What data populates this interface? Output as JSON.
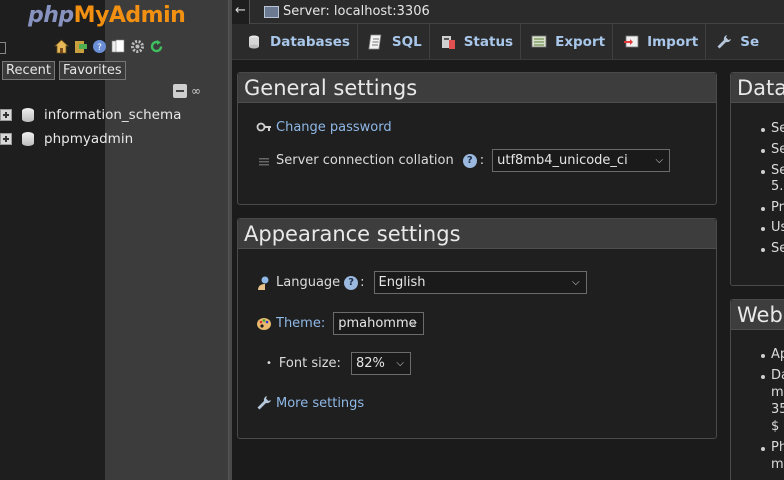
{
  "logo": {
    "php": "php",
    "my": "My",
    "admin": "Admin"
  },
  "nav": {
    "tabs": [
      {
        "label": "Recent"
      },
      {
        "label": "Favorites"
      }
    ],
    "databases": [
      {
        "name": "information_schema"
      },
      {
        "name": "phpmyadmin"
      }
    ],
    "icons": [
      "home-icon",
      "logout-icon",
      "help-icon",
      "docs-icon",
      "settings-icon",
      "reload-icon"
    ]
  },
  "topbar": {
    "back_label": "←",
    "server_label": "Server: localhost:3306"
  },
  "menu": {
    "tabs": [
      {
        "label": "Databases",
        "icon": "databases-icon"
      },
      {
        "label": "SQL",
        "icon": "sql-icon"
      },
      {
        "label": "Status",
        "icon": "status-icon"
      },
      {
        "label": "Export",
        "icon": "export-icon"
      },
      {
        "label": "Import",
        "icon": "import-icon"
      },
      {
        "label": "Se",
        "icon": "settings-icon"
      }
    ]
  },
  "general": {
    "title": "General settings",
    "change_password": "Change password",
    "collation_label": "Server connection collation",
    "collation_value": "utf8mb4_unicode_ci"
  },
  "appearance": {
    "title": "Appearance settings",
    "language_label": "Language",
    "language_value": "English",
    "theme_label": "Theme:",
    "theme_value": "pmahomme",
    "font_label": "Font size:",
    "font_value": "82%",
    "more_settings": "More settings"
  },
  "right": {
    "db_title": "Data",
    "db_items": [
      "Se",
      "Se",
      "Se",
      "5.",
      "Pr",
      "Us",
      "Se"
    ],
    "web_title": "Web",
    "web_items": [
      "Ap",
      "Da",
      "m",
      "35",
      "$",
      "Ph",
      "m"
    ]
  },
  "colors": {
    "link": "#8fb8e6",
    "logo_php": "#8892bf",
    "logo_accent": "#f29111"
  }
}
